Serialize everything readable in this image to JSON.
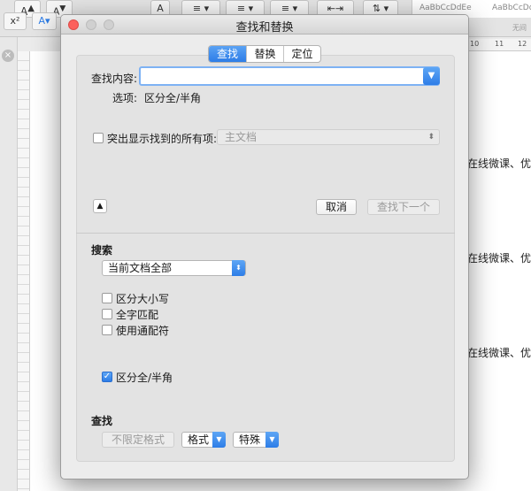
{
  "background": {
    "toolbar": {
      "superscript_label": "x²",
      "font_a_label": "A",
      "style_samples": [
        "AaBbCcDdEe",
        "AaBbCcDdEe"
      ],
      "style_names": [
        "",
        "无间"
      ]
    },
    "ruler_numbers": [
      "10",
      "11",
      "12"
    ],
    "doc_lines": [
      "在线微课、优点",
      "在线微课、优点",
      "在线微课、优点"
    ]
  },
  "dialog": {
    "title": "查找和替换",
    "tabs": [
      {
        "label": "查找",
        "active": true
      },
      {
        "label": "替换",
        "active": false
      },
      {
        "label": "定位",
        "active": false
      }
    ],
    "find_label": "查找内容:",
    "find_value": "",
    "options_label": "选项:",
    "options_value": "区分全/半角",
    "highlight_label": "突出显示找到的所有项:",
    "highlight_checked": false,
    "highlight_scope": "主文档",
    "expander_glyph": "▲",
    "cancel_label": "取消",
    "find_next_label": "查找下一个",
    "search_section": "搜索",
    "search_scope": "当前文档全部",
    "checkboxes": [
      {
        "label": "区分大小写",
        "checked": false
      },
      {
        "label": "全字匹配",
        "checked": false
      },
      {
        "label": "使用通配符",
        "checked": false
      },
      {
        "label": "区分全/半角",
        "checked": true
      }
    ],
    "find_section": "查找",
    "no_format_label": "不限定格式",
    "format_label": "格式",
    "special_label": "特殊"
  },
  "colors": {
    "accent": "#2d7de7",
    "close": "#fc605c"
  }
}
